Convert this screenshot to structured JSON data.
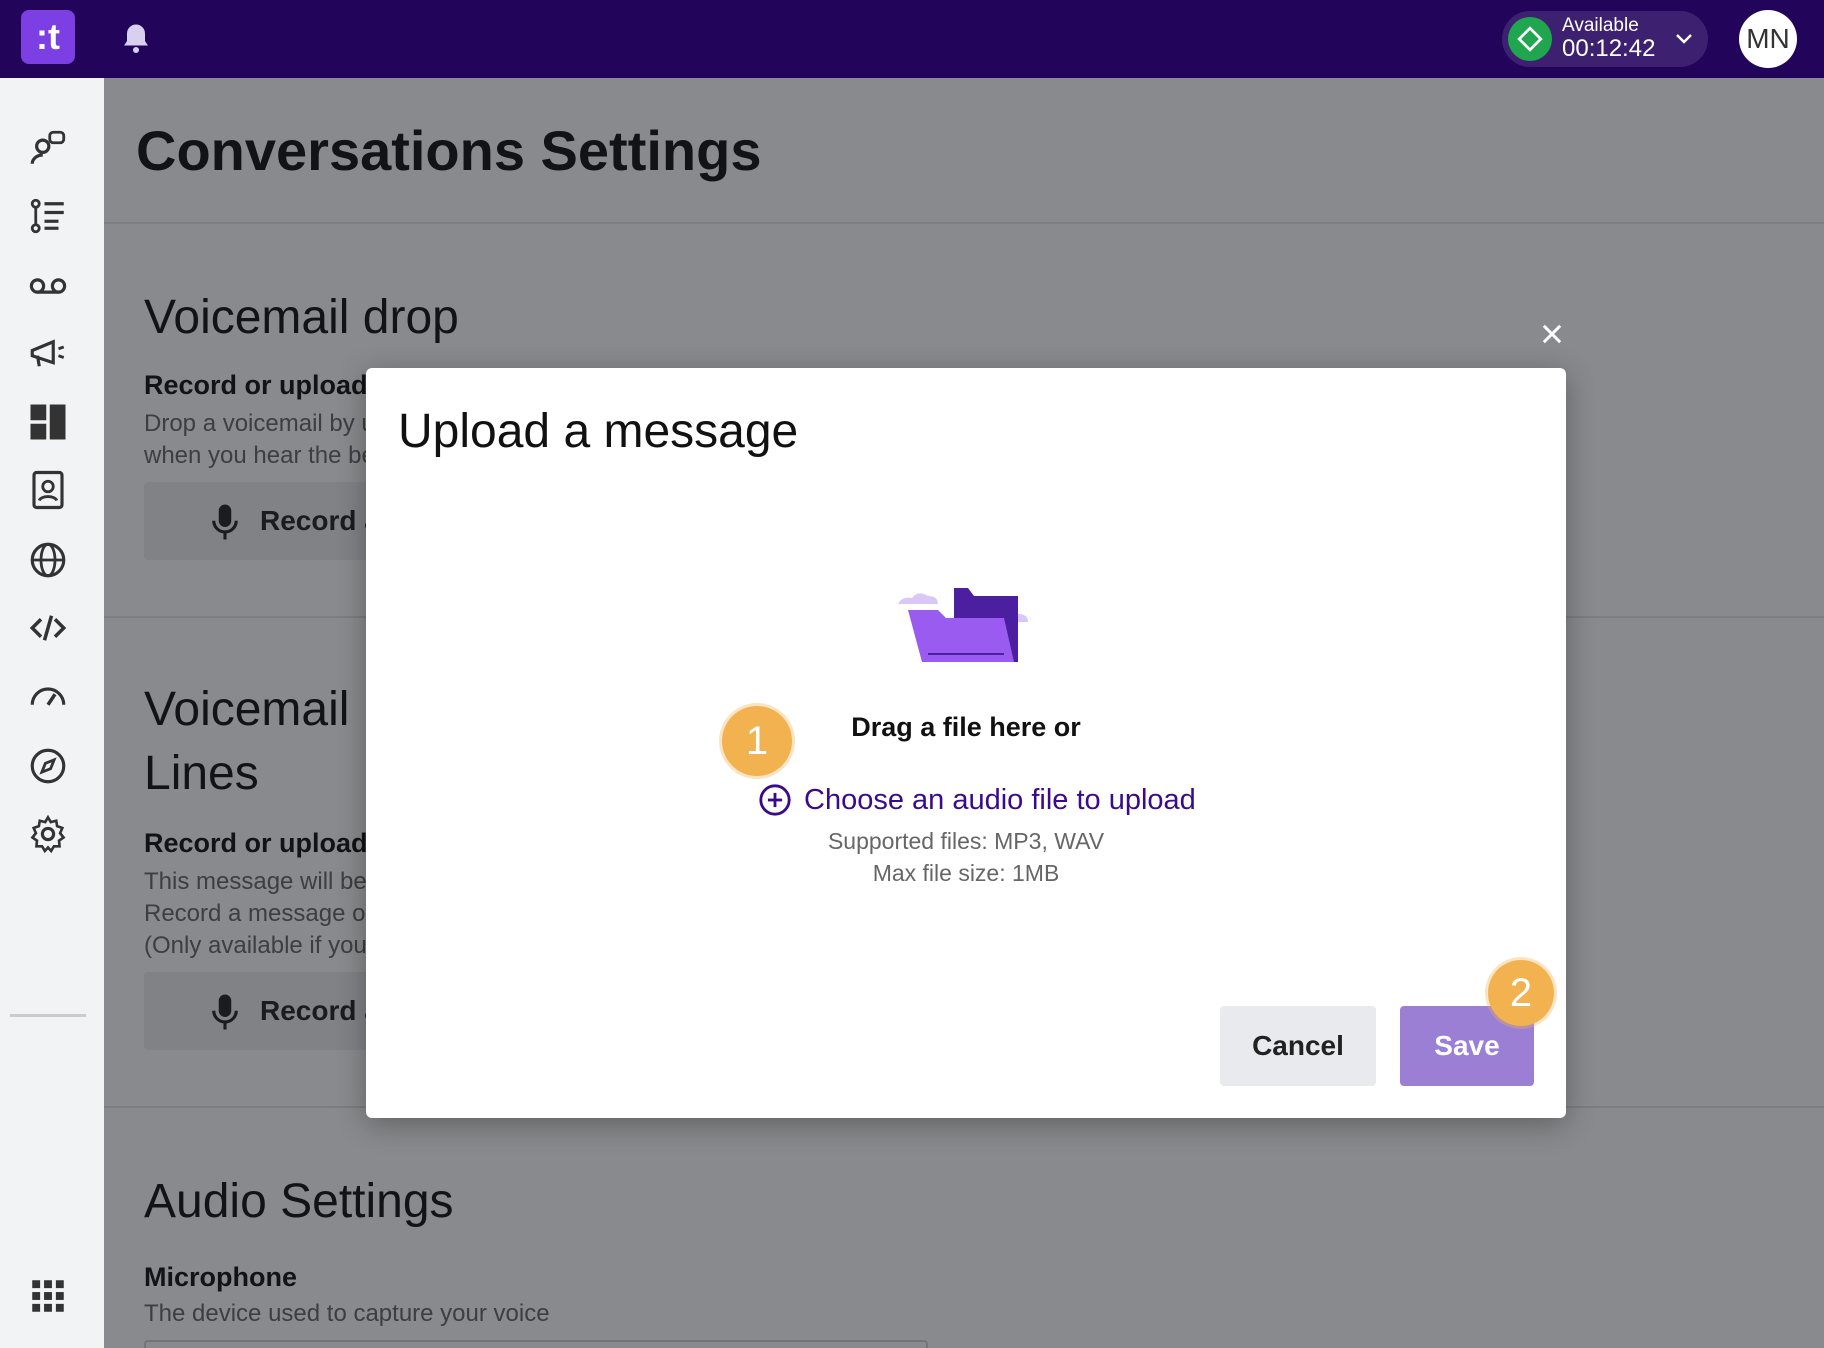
{
  "topbar": {
    "logo_text": ":t",
    "status_label": "Available",
    "status_time": "00:12:42",
    "avatar_initials": "MN"
  },
  "sidebar": {
    "icons": [
      "conversations-icon",
      "list-icon",
      "voicemail-icon",
      "megaphone-icon",
      "dashboard-icon",
      "contacts-icon",
      "globe-icon",
      "code-icon",
      "speedometer-icon",
      "compass-icon",
      "settings-icon"
    ],
    "bottom_icon": "apps-grid-icon"
  },
  "main": {
    "page_title": "Conversations Settings",
    "voicemail_drop": {
      "title": "Voicemail drop",
      "subtitle": "Record or upload",
      "desc_line1": "Drop a voicemail by u",
      "desc_line2": "when you hear the be",
      "record_label": "Record a"
    },
    "voicemail_lines": {
      "title_line1": "Voicemail",
      "title_line2": "Lines",
      "subtitle": "Record or upload",
      "desc_line1": "This message will be",
      "desc_line2": "Record a message or",
      "desc_line3": "(Only available if you",
      "record_label": "Record a"
    },
    "audio_settings": {
      "title": "Audio Settings",
      "subtitle": "Microphone",
      "desc": "The device used to capture your voice"
    }
  },
  "modal": {
    "title": "Upload a message",
    "drag_text": "Drag a file here or",
    "choose_link": "Choose an audio file to upload",
    "supported": "Supported files: MP3, WAV",
    "max_size": "Max file size: 1MB",
    "cancel_label": "Cancel",
    "save_label": "Save"
  },
  "steps": {
    "step1": "1",
    "step2": "2"
  },
  "colors": {
    "topbar": "#22045a",
    "brand": "#7b3fe4",
    "status_green": "#1fa64e",
    "link": "#3b0a8a",
    "save_button": "#9b7fd4",
    "step_marker": "#f2b250"
  }
}
